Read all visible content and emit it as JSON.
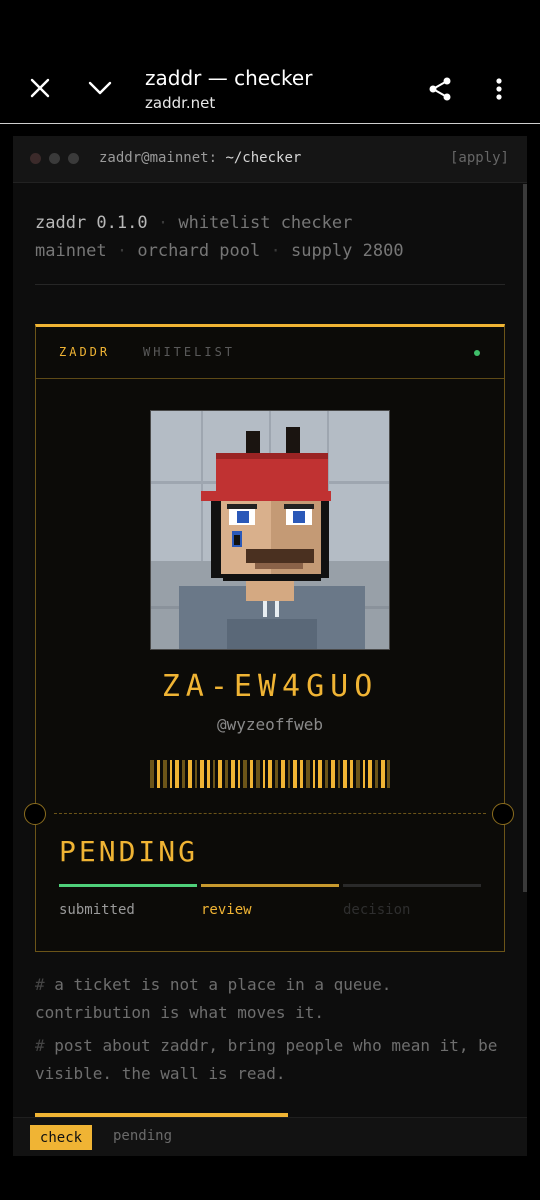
{
  "browser": {
    "title": "zaddr — checker",
    "url": "zaddr.net",
    "icons": [
      "close-icon",
      "chevron-down-icon",
      "share-icon",
      "more-vert-icon"
    ]
  },
  "terminal": {
    "prompt_user": "zaddr@mainnet:",
    "prompt_path": "~/checker",
    "apply_label": "[apply]"
  },
  "meta": {
    "line1": {
      "name": "zaddr 0.1.0",
      "sep": "·",
      "desc": "whitelist checker"
    },
    "line2": {
      "network": "mainnet",
      "sep1": "·",
      "pool": "orchard pool",
      "sep2": "·",
      "supply": "supply 2800"
    }
  },
  "ticket": {
    "brand": "ZADDR",
    "brand_sub": "WHITELIST",
    "code": "ZA-EW4GUO",
    "handle": "@wyzeoffweb",
    "status": "PENDING",
    "steps": [
      {
        "label": "submitted",
        "state": "done",
        "color": "#4fd07a"
      },
      {
        "label": "review",
        "state": "active",
        "color": "#f0b434"
      },
      {
        "label": "decision",
        "state": "todo",
        "color": "#2a2a2a"
      }
    ]
  },
  "notes": [
    {
      "hash": "#",
      "text": "a ticket is not a place in a queue. contribution is what moves it."
    },
    {
      "hash": "#",
      "text": "post about zaddr, bring people who mean it, be visible. the wall is read."
    }
  ],
  "footer": {
    "check_label": "check",
    "pending_label": "pending"
  },
  "colors": {
    "accent": "#f0b434",
    "success": "#4fd07a",
    "background": "#0d0d0d"
  }
}
